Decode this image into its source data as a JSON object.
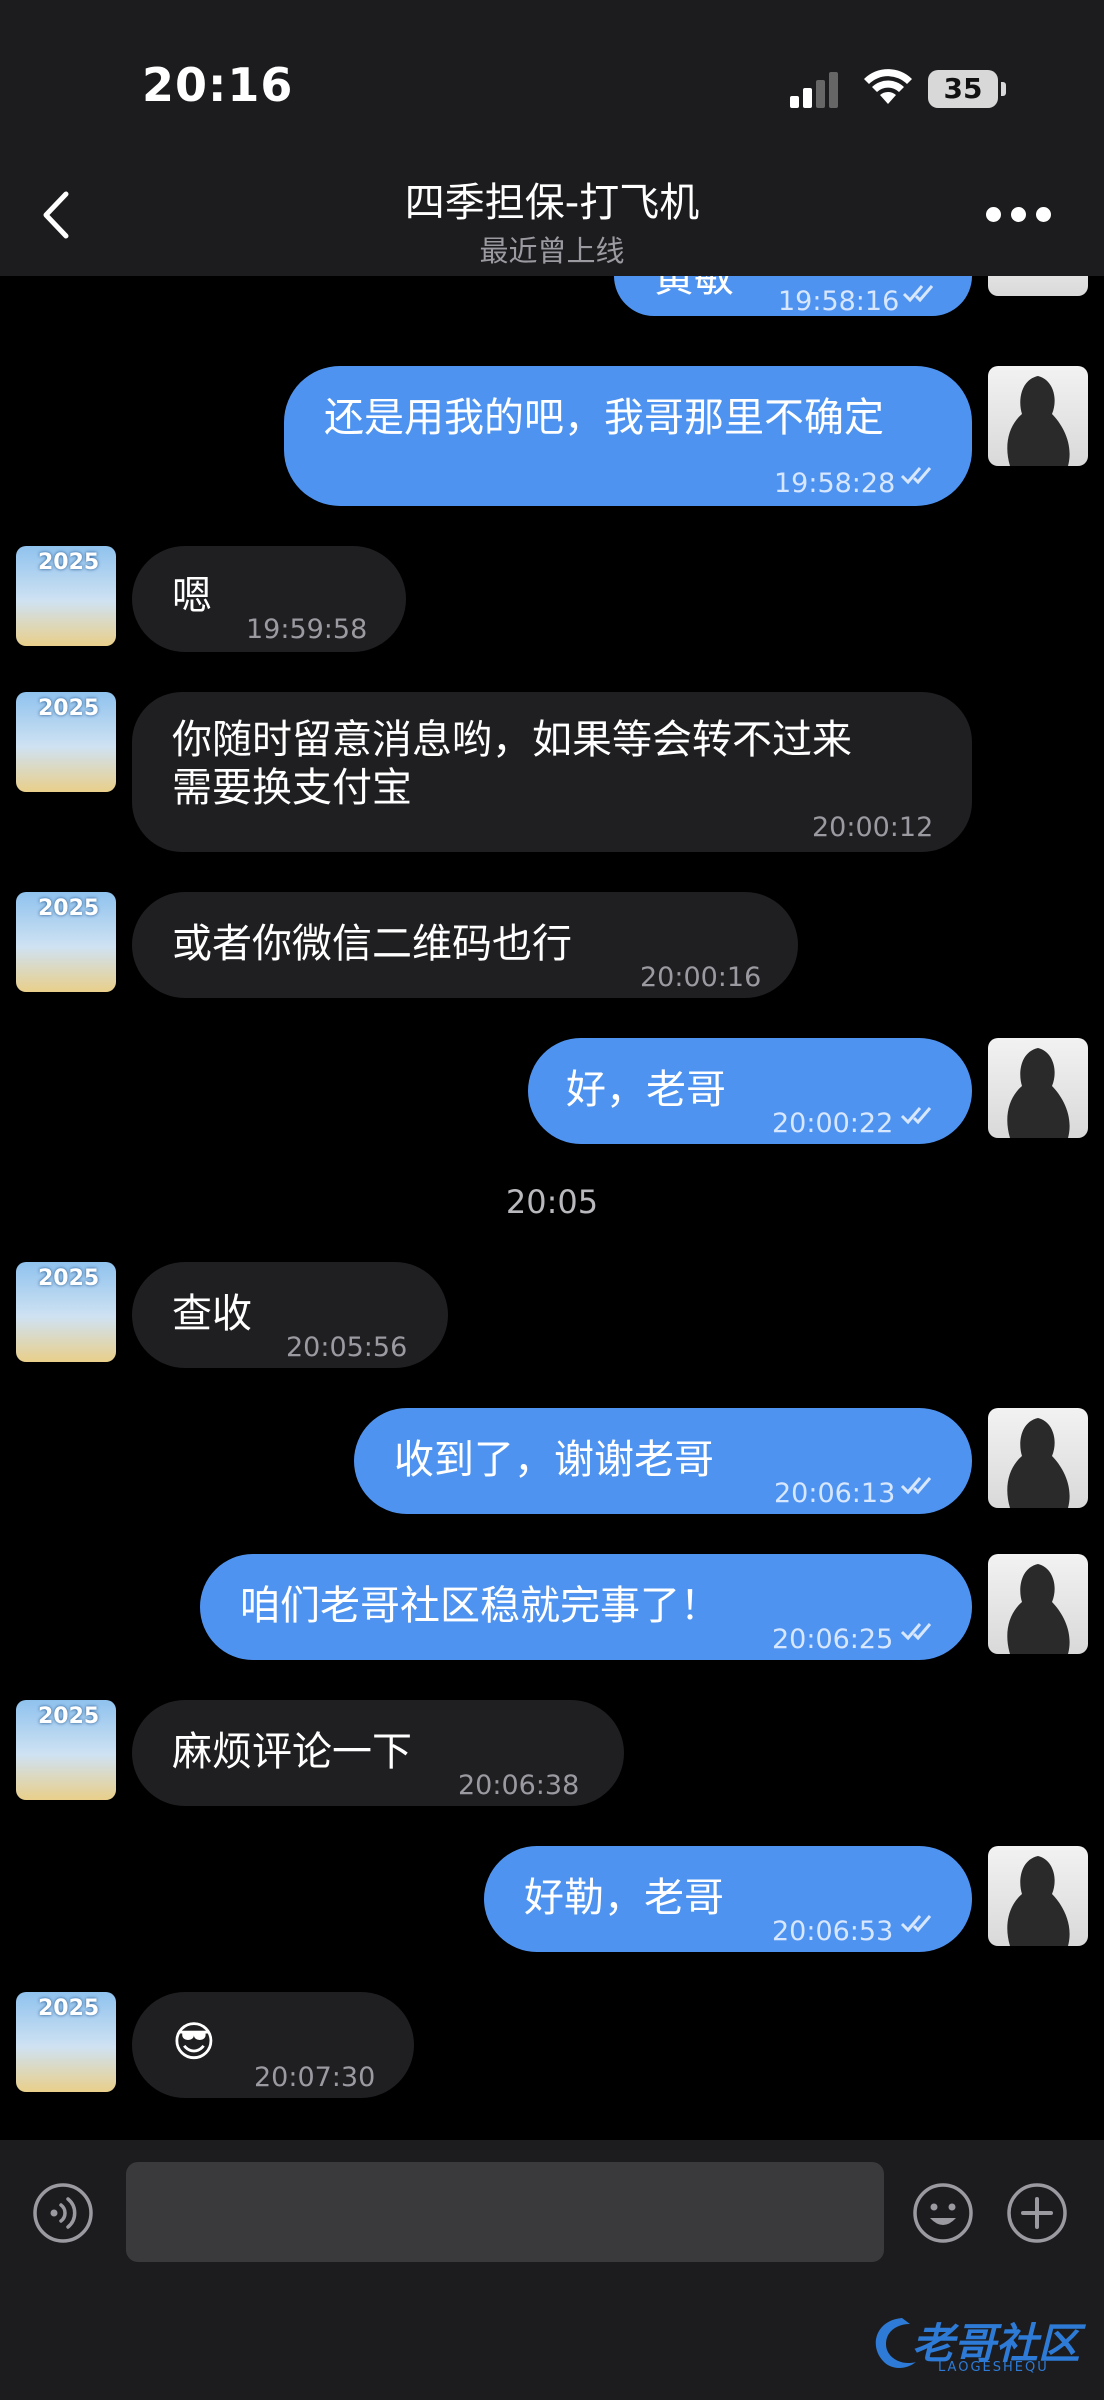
{
  "status_bar": {
    "time": "20:16",
    "battery": "35"
  },
  "header": {
    "title": "四季担保-打飞机",
    "subtitle": "最近曾上线"
  },
  "date_separator": "20:05",
  "messages": [
    {
      "side": "out",
      "text": "黄敏",
      "time": "19:58:16"
    },
    {
      "side": "out",
      "text": "还是用我的吧，我哥那里不确定",
      "time": "19:58:28"
    },
    {
      "side": "in",
      "text": "嗯",
      "time": "19:59:58"
    },
    {
      "side": "in",
      "text": "你随时留意消息哟，如果等会转不过来",
      "text2": "需要换支付宝",
      "time": "20:00:12"
    },
    {
      "side": "in",
      "text": "或者你微信二维码也行",
      "time": "20:00:16"
    },
    {
      "side": "out",
      "text": "好，老哥",
      "time": "20:00:22"
    },
    {
      "side": "in",
      "text": "查收",
      "time": "20:05:56"
    },
    {
      "side": "out",
      "text": "收到了，谢谢老哥",
      "time": "20:06:13"
    },
    {
      "side": "out",
      "text": "咱们老哥社区稳就完事了！",
      "time": "20:06:25"
    },
    {
      "side": "in",
      "text": "麻烦评论一下",
      "time": "20:06:38"
    },
    {
      "side": "out",
      "text": "好勒，老哥",
      "time": "20:06:53"
    },
    {
      "side": "in",
      "text": "😎",
      "time": "20:07:30"
    }
  ],
  "avatar_in_badge": "2025",
  "watermark": {
    "text": "老哥社区",
    "sub": "LAOGESHEQU"
  },
  "icons": {
    "back": "chevron-left-icon",
    "more": "more-icon",
    "voice": "voice-icon",
    "emoji": "emoji-icon",
    "plus": "plus-icon"
  }
}
